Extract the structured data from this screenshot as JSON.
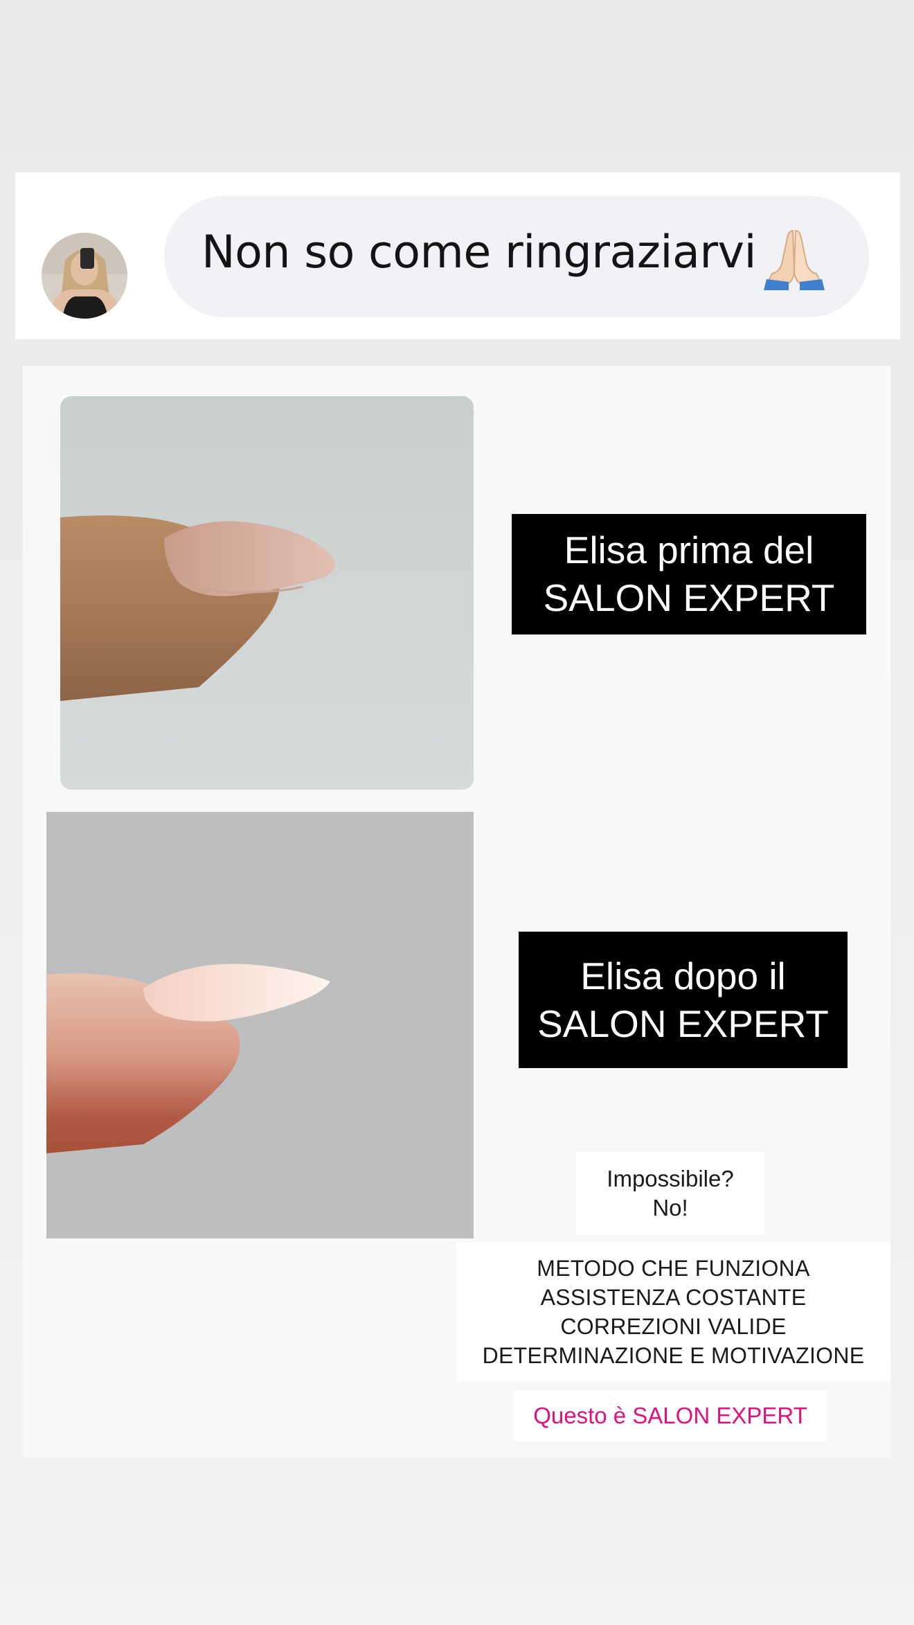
{
  "message": {
    "text": "Non so come ringraziarvi",
    "emoji_icon": "folded-hands-icon"
  },
  "avatar": {
    "icon": "user-avatar-photo"
  },
  "before": {
    "label_line1": "Elisa prima del",
    "label_line2": "SALON EXPERT"
  },
  "after": {
    "label_line1": "Elisa dopo il",
    "label_line2": "SALON EXPERT"
  },
  "impossible": {
    "line1": "Impossibile?",
    "line2": "No!"
  },
  "features": [
    "METODO CHE FUNZIONA",
    "ASSISTENZA COSTANTE",
    "CORREZIONI VALIDE",
    "DETERMINAZIONE E MOTIVAZIONE"
  ],
  "cta": {
    "text": "Questo è SALON EXPERT"
  },
  "colors": {
    "cta": "#e0107f",
    "label_bg": "#000000",
    "bubble_bg": "#f1f2f5"
  }
}
